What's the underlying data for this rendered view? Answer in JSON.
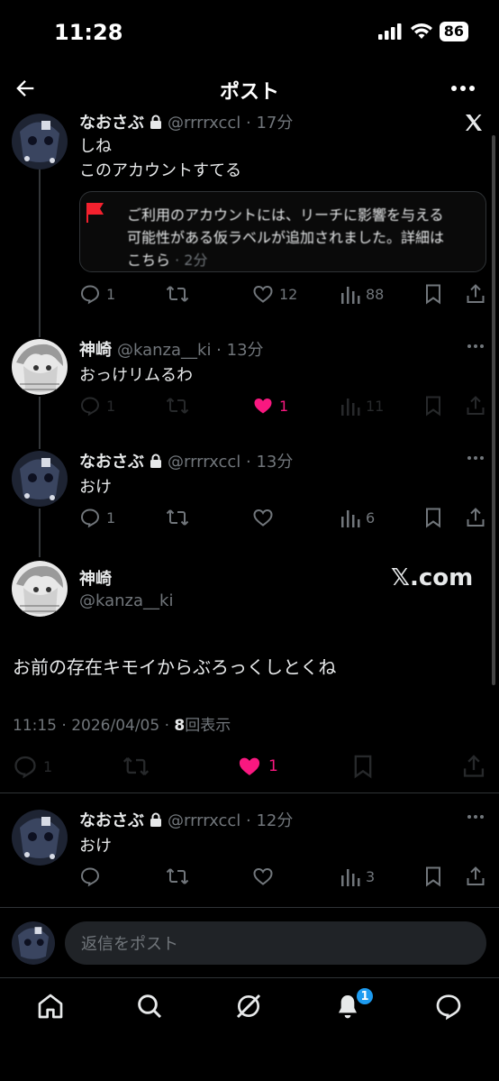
{
  "status_bar": {
    "time": "11:28",
    "battery": "86"
  },
  "header": {
    "title": "ポスト"
  },
  "posts": [
    {
      "name": "なおさぶ",
      "meta": "@rrrrxccl · 17分",
      "text_lines": [
        "しね",
        "このアカウントすてる"
      ],
      "label_notice": {
        "line1": "ご利用のアカウントには、リーチに影響を与える",
        "line2": "可能性がある仮ラベルが追加されました。詳細は",
        "line3_link": "こちら",
        "line3_time": " · 2分"
      },
      "replies": "1",
      "reposts": "",
      "likes": "12",
      "views": "88"
    },
    {
      "name": "神崎",
      "meta": "@kanza__ki · 13分",
      "text_lines": [
        "おっけリムるわ"
      ],
      "replies": "1",
      "reposts": "",
      "likes": "1",
      "views": "11"
    },
    {
      "name": "なおさぶ",
      "meta": "@rrrrxccl · 13分",
      "text_lines": [
        "おけ"
      ],
      "replies": "1",
      "reposts": "",
      "likes": "",
      "views": "6"
    }
  ],
  "main_post": {
    "name": "神崎",
    "handle": "@kanza__ki",
    "watermark": "𝕏.com",
    "text": "お前の存在キモイからぶろっくしとくね",
    "timestamp": "11:15 · 2026/04/05 · ",
    "view_count": "8",
    "view_label": "回表示",
    "replies": "1",
    "likes": "1"
  },
  "reply_post": {
    "name": "なおさぶ",
    "meta": "@rrrrxccl · 12分",
    "text": "おけ",
    "views": "3"
  },
  "composer": {
    "placeholder": "返信をポスト"
  },
  "tab_bar": {
    "notifications_badge": "1"
  },
  "colors": {
    "like_pink": "#f91880",
    "accent_blue": "#1d9bf0",
    "label_red": "#f4212e"
  }
}
